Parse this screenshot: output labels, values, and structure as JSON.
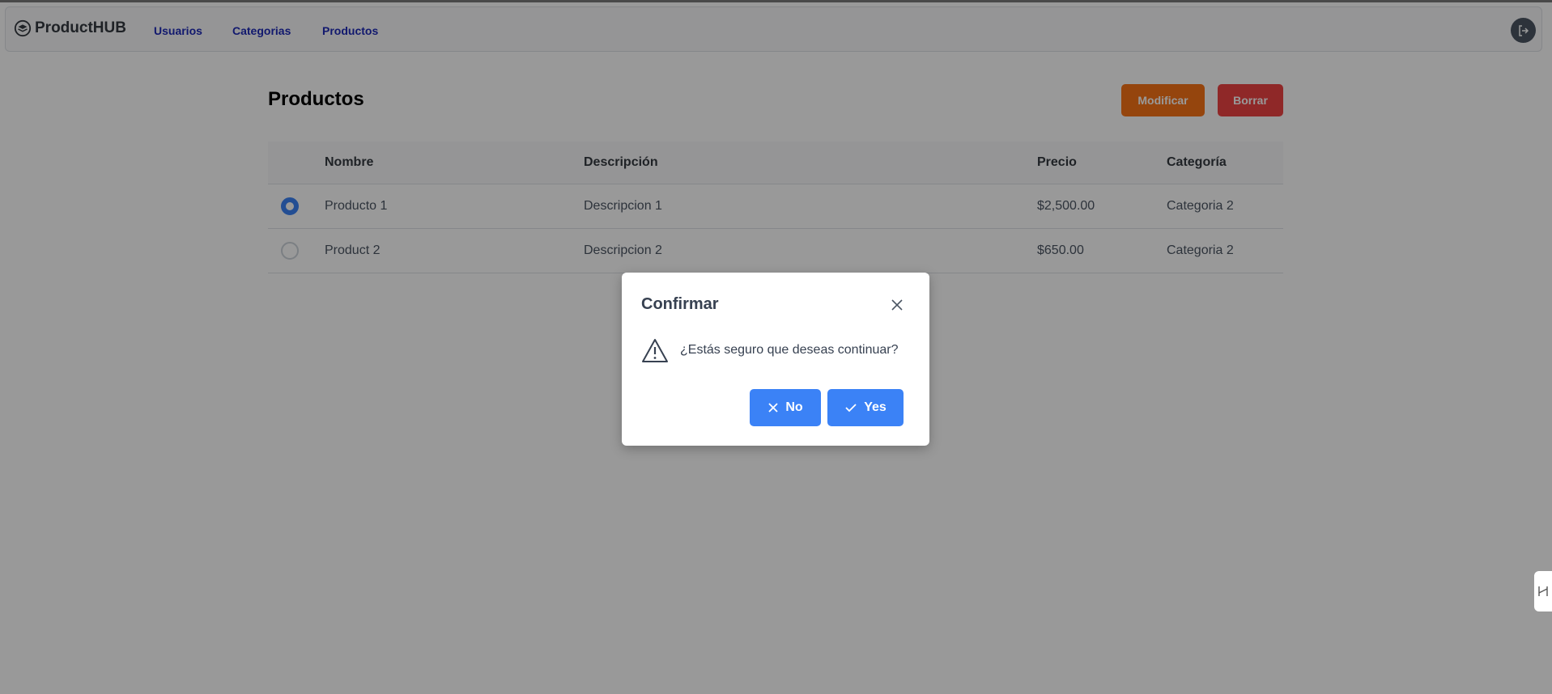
{
  "navbar": {
    "brand": "ProductHUB",
    "links": [
      "Usuarios",
      "Categorias",
      "Productos"
    ]
  },
  "page": {
    "title": "Productos",
    "modify_label": "Modificar",
    "delete_label": "Borrar"
  },
  "table": {
    "headers": [
      "Nombre",
      "Descripción",
      "Precio",
      "Categoría"
    ],
    "rows": [
      {
        "selected": true,
        "nombre": "Producto 1",
        "descripcion": "Descripcion 1",
        "precio": "$2,500.00",
        "categoria": "Categoria 2"
      },
      {
        "selected": false,
        "nombre": "Product 2",
        "descripcion": "Descripcion 2",
        "precio": "$650.00",
        "categoria": "Categoria 2"
      }
    ]
  },
  "dialog": {
    "title": "Confirmar",
    "message": "¿Estás seguro que deseas continuar?",
    "no_label": "No",
    "yes_label": "Yes"
  },
  "colors": {
    "accent": "#3b82f6",
    "modify": "#f97316",
    "delete": "#ef4444",
    "nav_link": "#1e2ab8"
  }
}
